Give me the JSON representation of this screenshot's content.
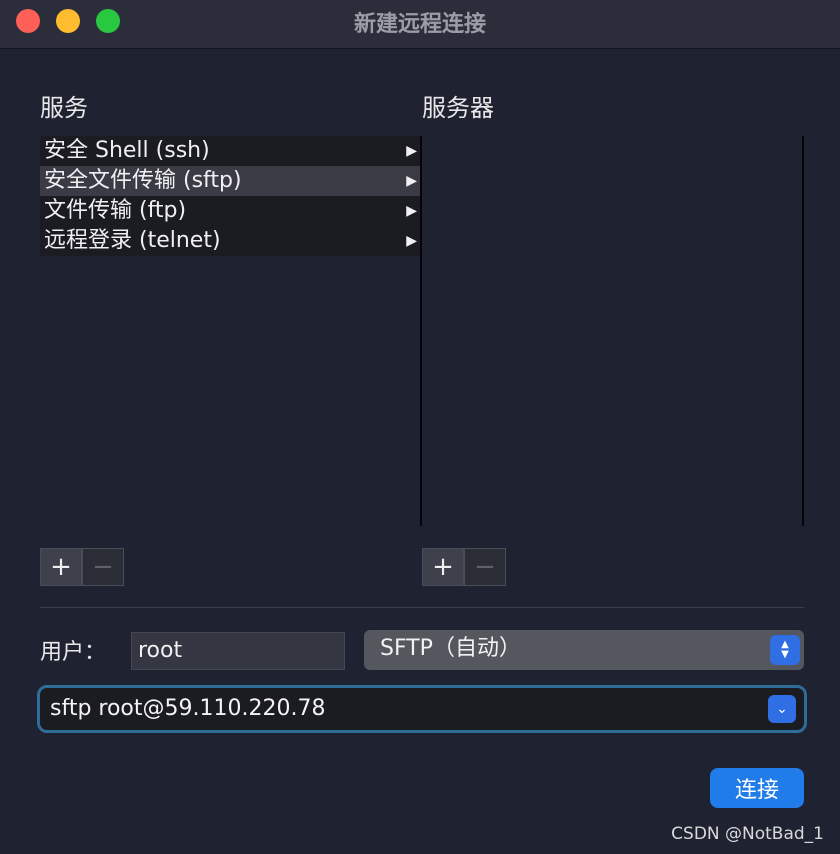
{
  "window": {
    "title": "新建远程连接"
  },
  "columns": {
    "services_label": "服务",
    "servers_label": "服务器"
  },
  "services": [
    {
      "label": "安全 Shell (ssh)"
    },
    {
      "label": "安全文件传输 (sftp)"
    },
    {
      "label": "文件传输 (ftp)"
    },
    {
      "label": "远程登录 (telnet)"
    }
  ],
  "icons": {
    "arrow": "▶",
    "plus": "+",
    "minus": "−",
    "stepper_up": "▲",
    "stepper_down": "▼",
    "dropdown": "⌄"
  },
  "form": {
    "user_label": "用户：",
    "user_value": "root",
    "protocol_value": "SFTP（自动）",
    "command_value": "sftp root@59.110.220.78"
  },
  "buttons": {
    "connect_label": "连接"
  },
  "watermark": "CSDN @NotBad_1"
}
